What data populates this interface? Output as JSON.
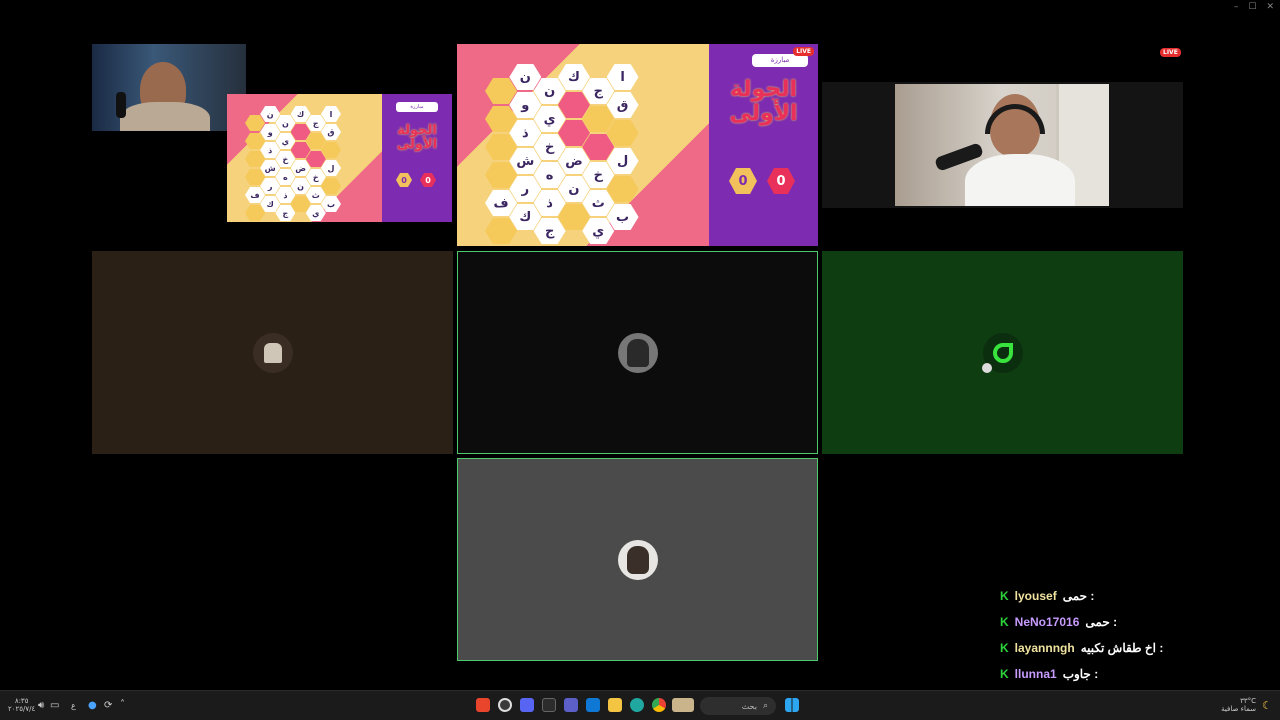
{
  "window": {
    "minimize": "–",
    "maximize": "☐",
    "close": "✕"
  },
  "board": {
    "round_title_line1": "الجولة",
    "round_title_line2": "الأولى",
    "label_button": "مبارزة",
    "live": "LIVE",
    "score_left": "0",
    "score_right": "0",
    "letters": [
      {
        "c": "ا",
        "r": 0,
        "k": 0
      },
      {
        "c": "ج",
        "r": 0,
        "k": 1
      },
      {
        "c": "ك",
        "r": 0,
        "k": 2
      },
      {
        "c": "ن",
        "r": 0,
        "k": 3
      },
      {
        "c": "ن",
        "r": 0,
        "k": 4
      },
      {
        "c": "ق",
        "r": 1,
        "k": 0
      },
      {
        "c": "ي",
        "r": 1,
        "k": 3
      },
      {
        "c": "و",
        "r": 1,
        "k": 4
      },
      {
        "c": "خ",
        "r": 2,
        "k": 3
      },
      {
        "c": "ذ",
        "r": 2,
        "k": 4
      },
      {
        "c": "ل",
        "r": 3,
        "k": 0
      },
      {
        "c": "خ",
        "r": 3,
        "k": 1
      },
      {
        "c": "ض",
        "r": 3,
        "k": 2
      },
      {
        "c": "ه",
        "r": 3,
        "k": 3
      },
      {
        "c": "ش",
        "r": 3,
        "k": 4
      },
      {
        "c": "ث",
        "r": 4,
        "k": 1
      },
      {
        "c": "ن",
        "r": 4,
        "k": 2
      },
      {
        "c": "ذ",
        "r": 4,
        "k": 3
      },
      {
        "c": "ر",
        "r": 4,
        "k": 4
      },
      {
        "c": "ف",
        "r": 4,
        "k": 5
      },
      {
        "c": "ب",
        "r": 5,
        "k": 0
      },
      {
        "c": "ي",
        "r": 5,
        "k": 1
      },
      {
        "c": "ج",
        "r": 5,
        "k": 3
      },
      {
        "c": "ك",
        "r": 5,
        "k": 4
      }
    ]
  },
  "live_badge": "LIVE",
  "chat": [
    {
      "user": "lyousef",
      "message": "حمى :",
      "color": "#f0e3a0"
    },
    {
      "user": "NeNo17016",
      "message": "حمى :",
      "color": "#c89bff"
    },
    {
      "user": "layannngh",
      "message": "اخ طقاش تكبيه :",
      "color": "#f0e3a0"
    },
    {
      "user": "llunna1",
      "message": "جاوب :",
      "color": "#c89bff"
    }
  ],
  "taskbar": {
    "search_label": "بحث",
    "tray_left_time": "٨:٣٥",
    "tray_left_date": "٢٠٢٥/٧/٤",
    "lang": "ع",
    "weather_temp": "٣٣°C",
    "weather_text": "سماء صافية"
  },
  "colors": {
    "board_bg_yellow": "#f5d27b",
    "board_bg_pink": "#ee6a86",
    "panel_purple": "#7d2bb0",
    "green_tile": "#0e3d12",
    "brown_tile": "#2b2016",
    "gray_tile": "#4b4b4b"
  }
}
